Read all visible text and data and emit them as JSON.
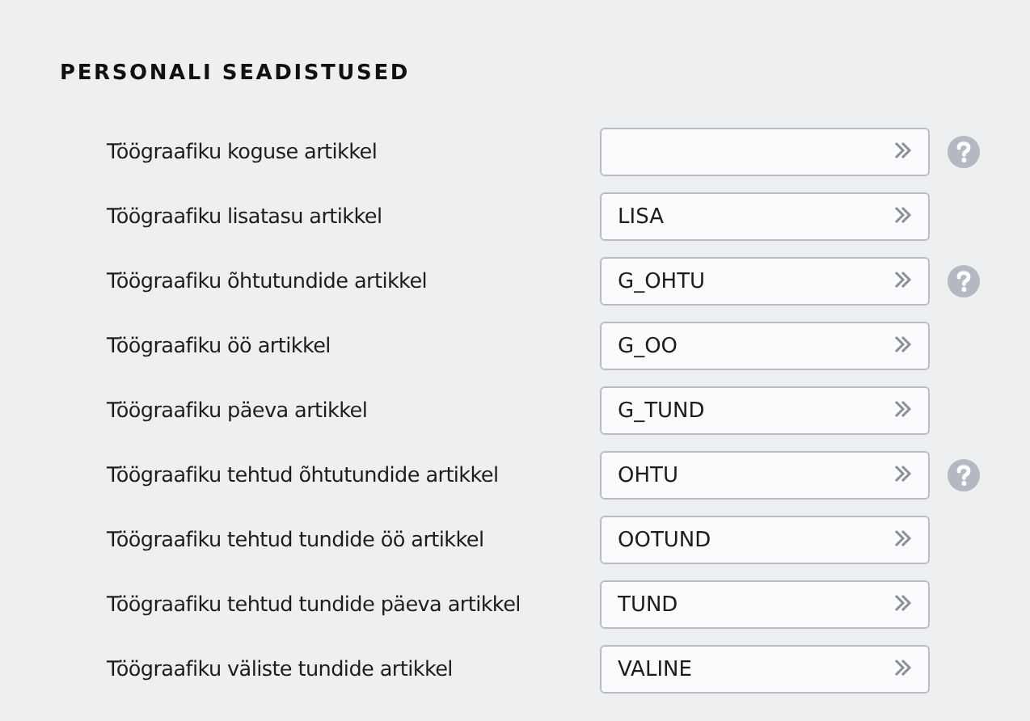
{
  "section_title": "PERSONALI SEADISTUSED",
  "rows": [
    {
      "label": "Töögraafiku koguse artikkel",
      "value": "",
      "has_help": true
    },
    {
      "label": "Töögraafiku lisatasu artikkel",
      "value": "LISA",
      "has_help": false
    },
    {
      "label": "Töögraafiku õhtutundide artikkel",
      "value": "G_OHTU",
      "has_help": true
    },
    {
      "label": "Töögraafiku öö artikkel",
      "value": "G_OO",
      "has_help": false
    },
    {
      "label": "Töögraafiku päeva artikkel",
      "value": "G_TUND",
      "has_help": false
    },
    {
      "label": "Töögraafiku tehtud õhtutundide artikkel",
      "value": "OHTU",
      "has_help": true
    },
    {
      "label": "Töögraafiku tehtud tundide öö artikkel",
      "value": "OOTUND",
      "has_help": false
    },
    {
      "label": "Töögraafiku tehtud tundide päeva artikkel",
      "value": "TUND",
      "has_help": false
    },
    {
      "label": "Töögraafiku väliste tundide artikkel",
      "value": "VALINE",
      "has_help": false
    }
  ]
}
